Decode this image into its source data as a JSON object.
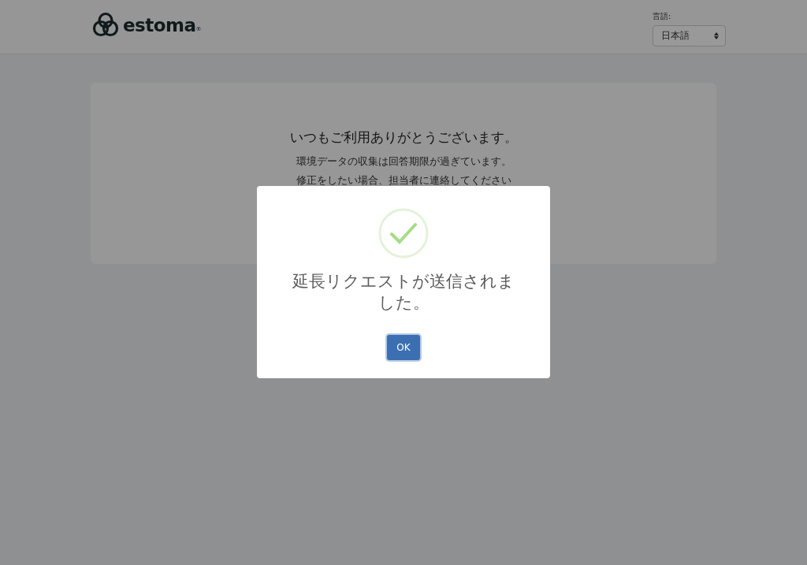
{
  "header": {
    "logo": {
      "text": "estoma",
      "mark": "®"
    },
    "language": {
      "label": "言語:",
      "value": "日本語"
    }
  },
  "card": {
    "heading": "いつもご利用ありがとうございます。",
    "lines": [
      "環境データの収集は回答期限が過ぎています。",
      "修正をしたい場合、担当者に連絡してください"
    ]
  },
  "dialog": {
    "kind": "success",
    "title": "延長リクエストが送信されました。",
    "buttons": [
      "OK"
    ]
  }
}
